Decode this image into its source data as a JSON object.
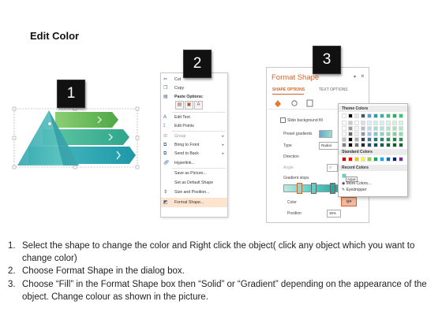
{
  "page_title": "Edit Color",
  "badges": [
    "1",
    "2",
    "3"
  ],
  "context_menu": {
    "items": [
      "Cut",
      "Copy",
      "Paste Options:",
      "Edit Text",
      "Edit Points",
      "Group",
      "Bring to Front",
      "Send to Back",
      "Hyperlink...",
      "Save as Picture...",
      "Set as Default Shape",
      "Size and Position...",
      "Format Shape..."
    ]
  },
  "format_pane": {
    "title": "Format Shape",
    "tabs": [
      "SHAPE OPTIONS",
      "TEXT OPTIONS"
    ],
    "slide_bg_fill": "Slide background fill",
    "preset_gradients": "Preset gradients",
    "type_label": "Type",
    "type_value": "Radial",
    "direction_label": "Direction",
    "angle_label": "Angle",
    "angle_value": "0°",
    "gradient_stops": "Gradient stops",
    "color_label": "Color",
    "position_label": "Position",
    "position_value": "35%"
  },
  "color_flyout": {
    "theme_colors": "Theme Colors",
    "standard_colors": "Standard Colors",
    "recent_colors": "Recent Colors",
    "recent_tooltip": "Aqua",
    "more_colors": "More Colors...",
    "eyedropper": "Eyedropper",
    "theme_top": [
      "#ffffff",
      "#000000",
      "#e7e6e6",
      "#44546a",
      "#5b9bd5",
      "#1aa3a8",
      "#33b5a0",
      "#3dbf7a",
      "#27ae60",
      "#2ecc71"
    ],
    "standard": [
      "#c00000",
      "#ff0000",
      "#ffc000",
      "#ffff00",
      "#92d050",
      "#00b050",
      "#00b0f0",
      "#0070c0",
      "#002060",
      "#7030a0"
    ],
    "recent": [
      "#59d1c7"
    ]
  },
  "instructions": [
    {
      "num": "1.",
      "text": "Select the shape to change the color and Right click the object( click any object which you want to change color)"
    },
    {
      "num": "2.",
      "text": "Choose Format Shape in the dialog box."
    },
    {
      "num": "3.",
      "text": "Choose “Fill” in the Format Shape box then “Solid” or “Gradient” depending on the appearance of the object. Change colour as shown in the picture."
    }
  ]
}
